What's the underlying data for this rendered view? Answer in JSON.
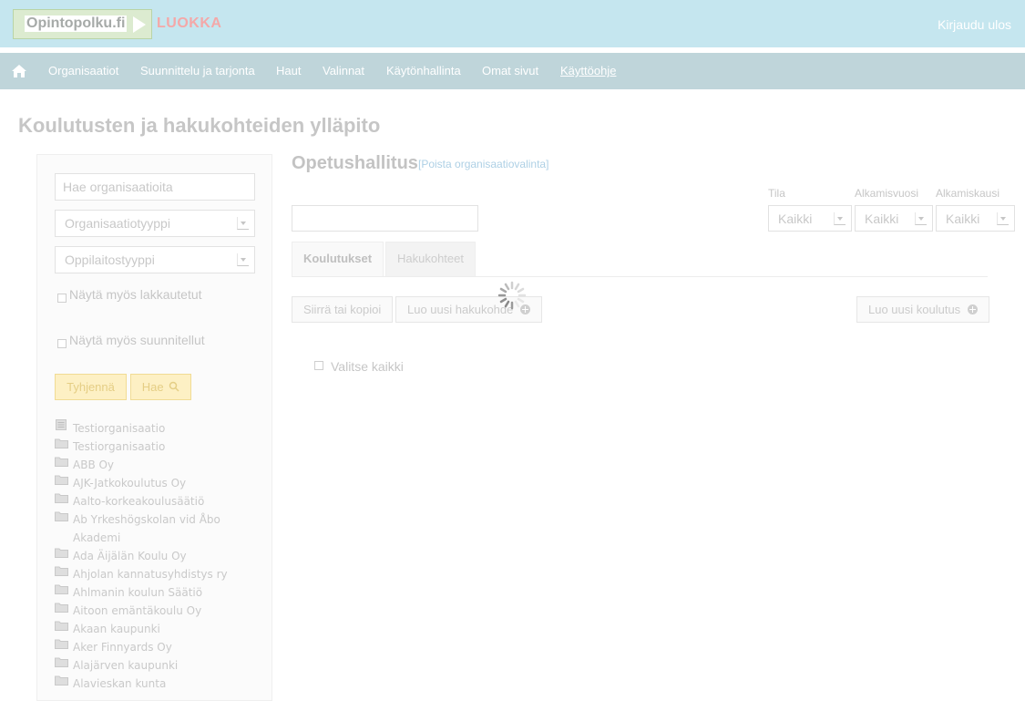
{
  "header": {
    "logo_text": "Opintopolku.fi",
    "env_label": "LUOKKA",
    "logout": "Kirjaudu ulos"
  },
  "nav": {
    "home_icon": "home-icon",
    "items": [
      {
        "label": "Organisaatiot"
      },
      {
        "label": "Suunnittelu ja tarjonta"
      },
      {
        "label": "Haut"
      },
      {
        "label": "Valinnat"
      },
      {
        "label": "Käytönhallinta"
      },
      {
        "label": "Omat sivut"
      },
      {
        "label": "Käyttöohje"
      }
    ]
  },
  "page": {
    "title": "Koulutusten ja hakukohteiden ylläpito"
  },
  "sidebar": {
    "search_placeholder": "Hae organisaatioita",
    "org_type": "Organisaatiotyyppi",
    "school_type": "Oppilaitostyyppi",
    "show_closed": "Näytä myös lakkautetut",
    "show_planned": "Näytä myös suunnitellut",
    "clear_button": "Tyhjennä",
    "search_button": "Hae",
    "tree": [
      {
        "label": "Testiorganisaatio",
        "icon": "document-icon"
      },
      {
        "label": "Testiorganisaatio",
        "icon": "folder-icon"
      },
      {
        "label": "ABB Oy",
        "icon": "folder-icon"
      },
      {
        "label": "AJK-Jatkokoulutus Oy",
        "icon": "folder-icon"
      },
      {
        "label": "Aalto-korkeakoulusäätiö",
        "icon": "folder-icon"
      },
      {
        "label": "Ab Yrkeshögskolan vid Åbo Akademi",
        "icon": "folder-icon"
      },
      {
        "label": "Ada Äijälän Koulu Oy",
        "icon": "folder-icon"
      },
      {
        "label": "Ahjolan kannatusyhdistys ry",
        "icon": "folder-icon"
      },
      {
        "label": "Ahlmanin koulun Säätiö",
        "icon": "folder-icon"
      },
      {
        "label": "Aitoon emäntäkoulu Oy",
        "icon": "folder-icon"
      },
      {
        "label": "Akaan kaupunki",
        "icon": "folder-icon"
      },
      {
        "label": "Aker Finnyards Oy",
        "icon": "folder-icon"
      },
      {
        "label": "Alajärven kaupunki",
        "icon": "folder-icon"
      },
      {
        "label": "Alavieskan kunta",
        "icon": "folder-icon"
      }
    ]
  },
  "main": {
    "org_name": "Opetushallitus",
    "org_remove": "[Poista organisaatiovalinta]",
    "filters": {
      "tila_label": "Tila",
      "tila_value": "Kaikki",
      "vuosi_label": "Alkamisvuosi",
      "vuosi_value": "Kaikki",
      "kausi_label": "Alkamiskausi",
      "kausi_value": "Kaikki"
    },
    "tabs": [
      {
        "label": "Koulutukset"
      },
      {
        "label": "Hakukohteet"
      }
    ],
    "buttons": {
      "move_copy": "Siirrä tai kopioi",
      "new_hakukohde": "Luo uusi hakukohde",
      "new_koulutus": "Luo uusi koulutus"
    },
    "select_all": "Valitse kaikki"
  },
  "colors": {
    "header_bg": "#c5e6ef",
    "nav_bg": "#bfd5da",
    "env_label": "#f4a8a8",
    "link": "#aed0e5",
    "yellow_button": "#fdf0c4"
  }
}
